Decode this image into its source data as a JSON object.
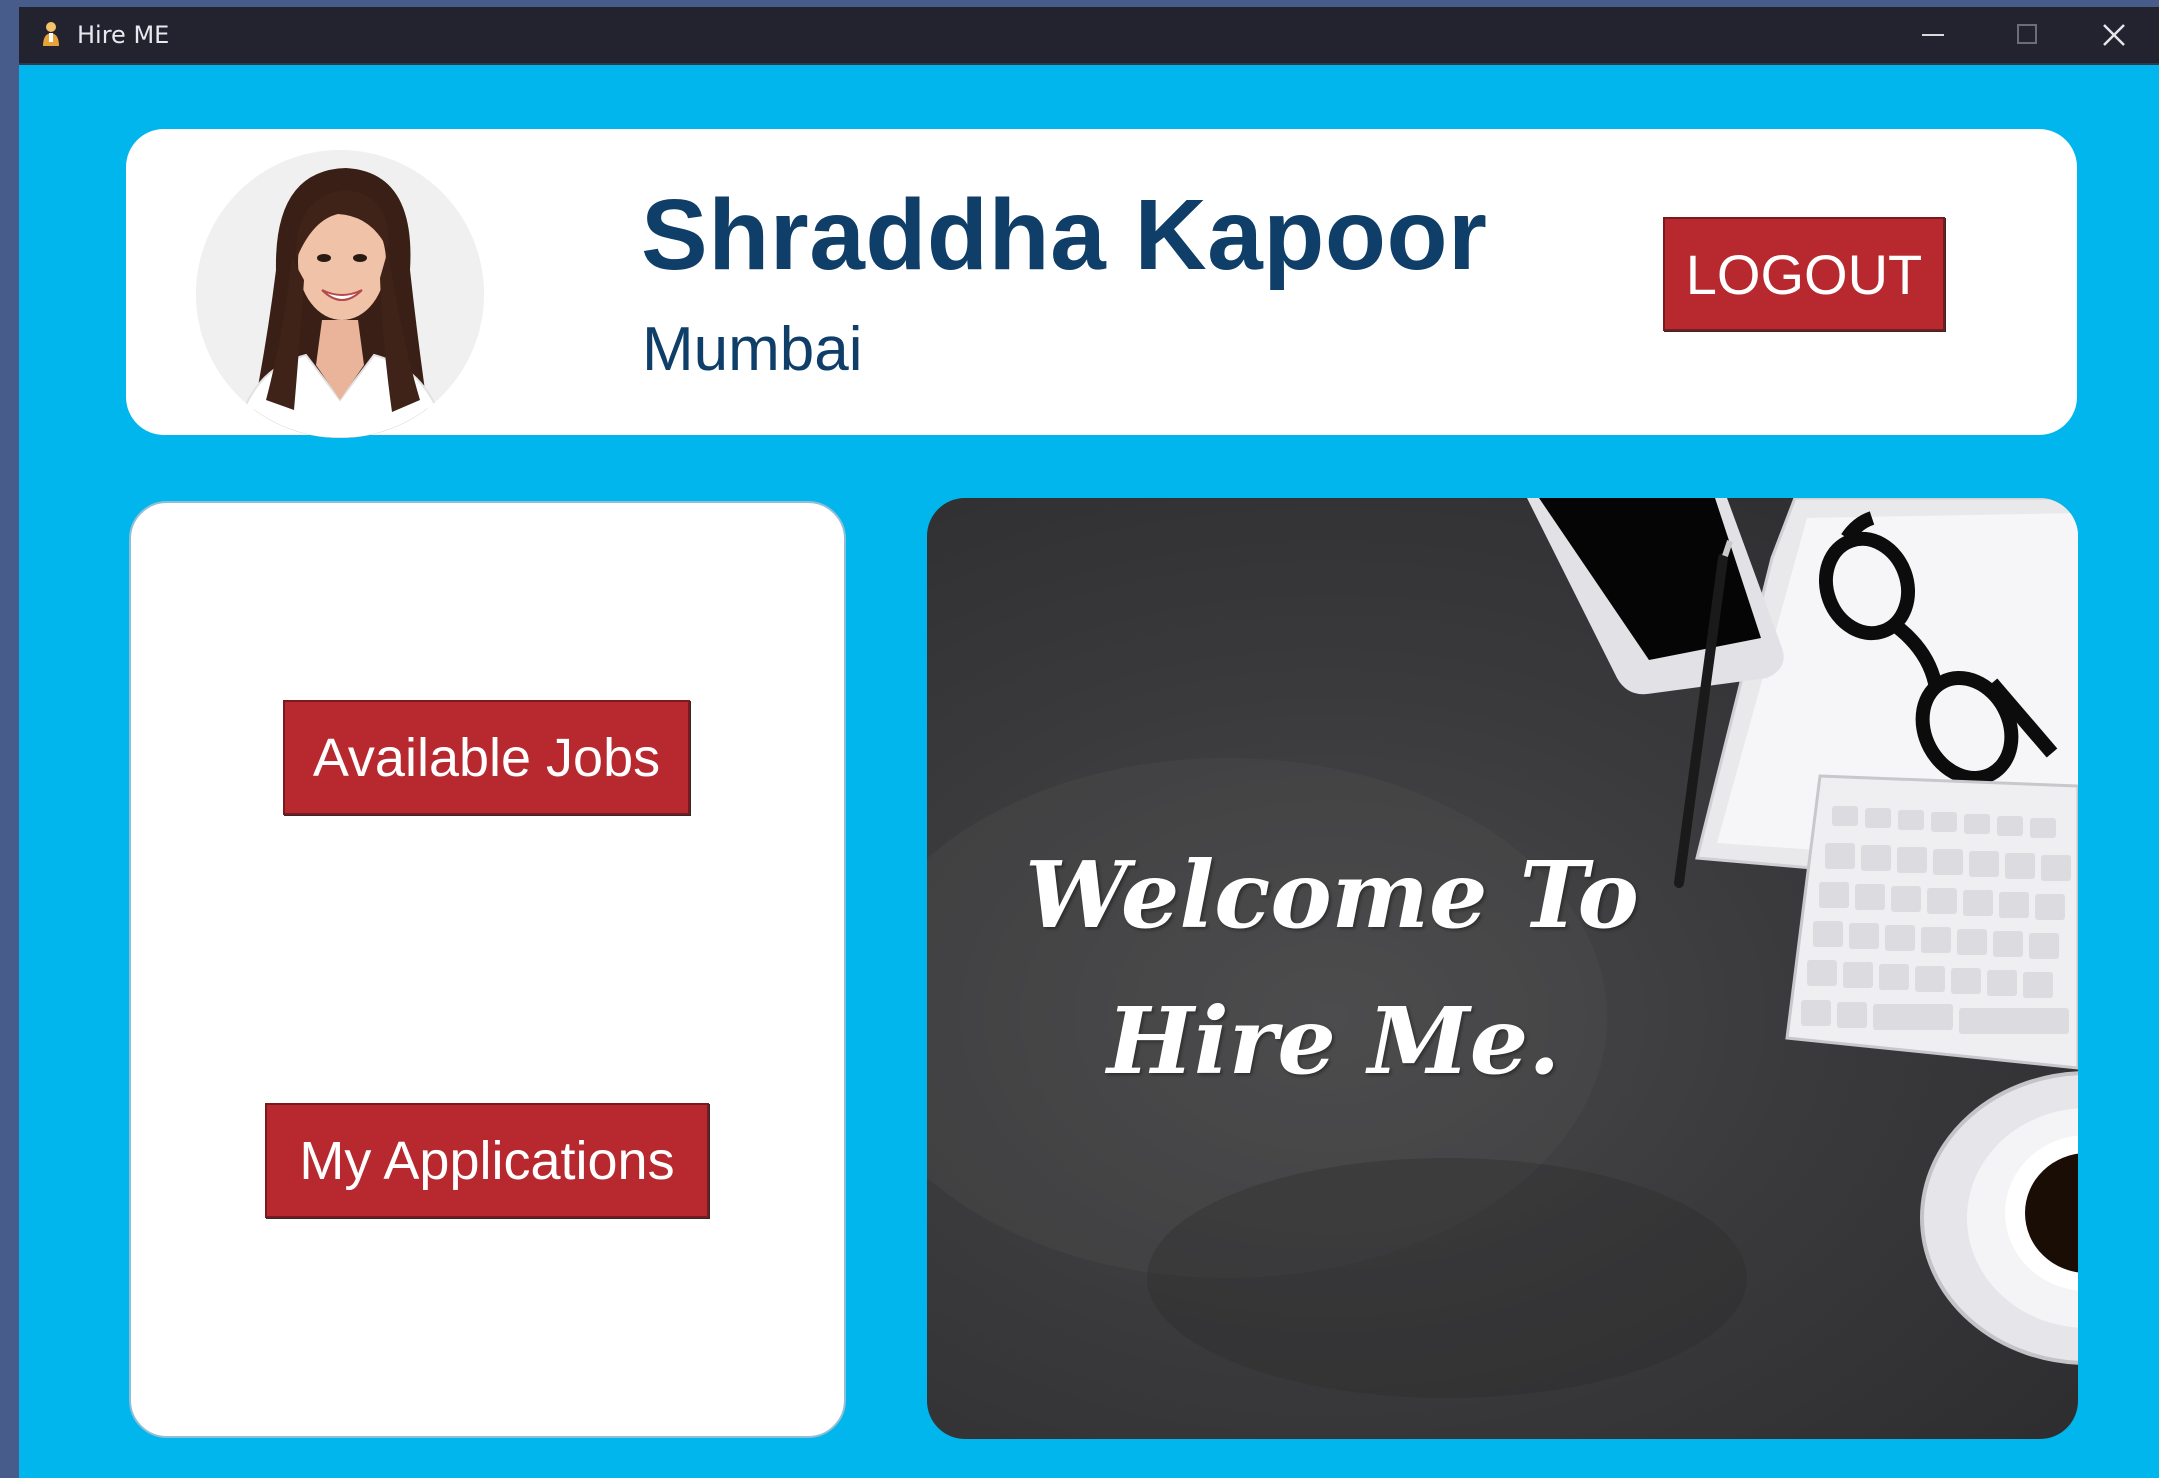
{
  "window": {
    "title": "Hire ME",
    "app_icon": "app-person-icon",
    "controls": [
      "minimize-icon",
      "maximize-icon",
      "close-icon"
    ]
  },
  "profile": {
    "name": "Shraddha Kapoor",
    "city": "Mumbai",
    "avatar": "profile-photo"
  },
  "header": {
    "logout_label": "LOGOUT"
  },
  "menu": {
    "available_jobs_label": "Available Jobs",
    "my_applications_label": "My Applications"
  },
  "welcome": {
    "line1": "Welcome To",
    "line2": "Hire Me."
  },
  "colors": {
    "background": "#00b6ec",
    "button": "#b8292f",
    "name_text": "#0f3e68",
    "titlebar": "#232330"
  }
}
